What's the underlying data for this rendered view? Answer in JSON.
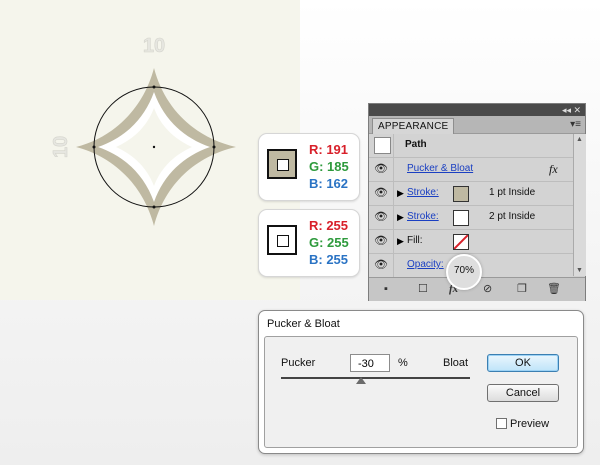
{
  "artboard": {
    "dimension_top": "10",
    "dimension_left": "10",
    "colors": {
      "background": "#f5f5ec",
      "stroke": "#bfb9a2",
      "inner_fill": "#ffffff",
      "circle": "#111111"
    }
  },
  "swatches": [
    {
      "r": "R: 191",
      "g": "G: 185",
      "b": "B: 162",
      "fill": "#bfb9a2"
    },
    {
      "r": "R: 255",
      "g": "G: 255",
      "b": "B: 255",
      "fill": "#ffffff"
    }
  ],
  "appearance": {
    "tab_label": "APPEARANCE",
    "header_label": "Path",
    "rows": [
      {
        "label": "Pucker & Bloat",
        "kind": "effect",
        "fx": "fx"
      },
      {
        "label": "Stroke:",
        "kind": "stroke",
        "swatch": "#bfb9a2",
        "value": "1 pt  Inside"
      },
      {
        "label": "Stroke:",
        "kind": "stroke",
        "swatch": "#ffffff",
        "value": "2 pt  Inside"
      },
      {
        "label": "Fill:",
        "kind": "fill",
        "swatch": "none"
      },
      {
        "label": "Opacity:",
        "kind": "opacity",
        "value": "70%"
      }
    ],
    "bottom_icons": [
      "square-icon",
      "new-fill-icon",
      "fx-icon",
      "clear-icon",
      "duplicate-icon",
      "trash-icon"
    ]
  },
  "dialog": {
    "title": "Pucker & Bloat",
    "left_label": "Pucker",
    "right_label": "Bloat",
    "value": "-30",
    "unit": "%",
    "ok_label": "OK",
    "cancel_label": "Cancel",
    "preview_label": "Preview",
    "preview_checked": false
  }
}
